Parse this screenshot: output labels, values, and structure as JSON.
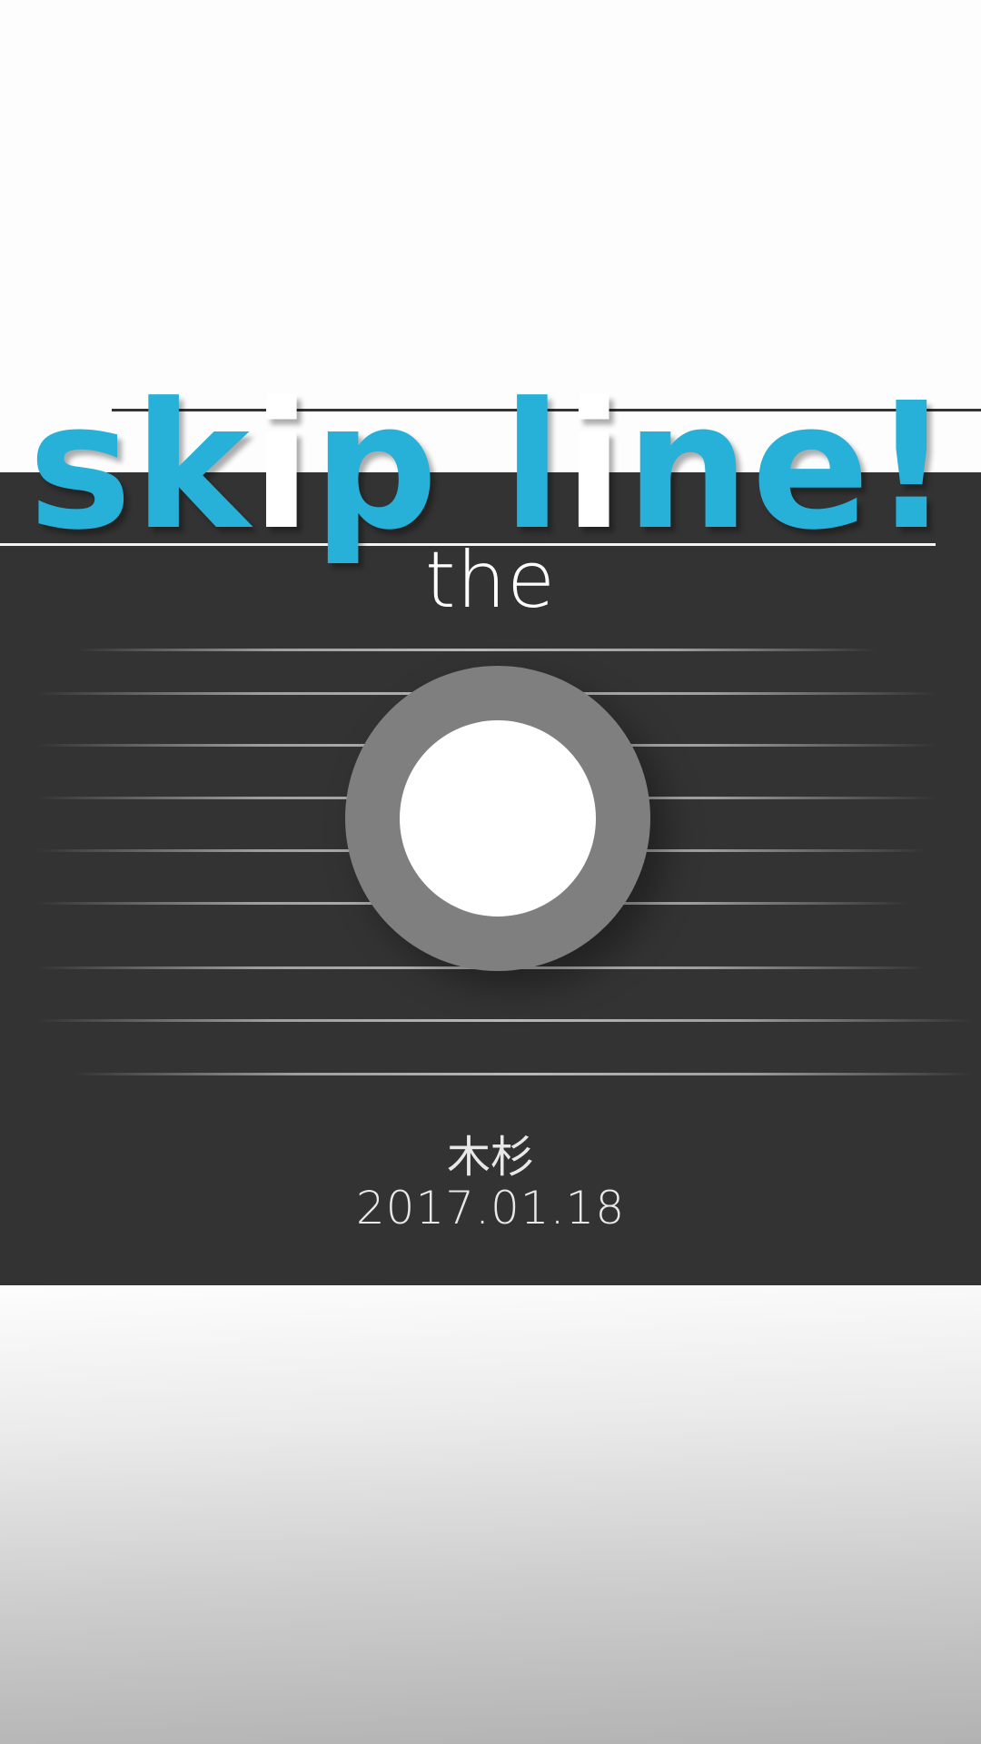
{
  "title": {
    "parts": [
      {
        "text": "sk",
        "highlight": false
      },
      {
        "text": "i",
        "highlight": true
      },
      {
        "text": "p l",
        "highlight": false
      },
      {
        "text": "i",
        "highlight": true
      },
      {
        "text": "ne!",
        "highlight": false
      }
    ],
    "accent_color": "#27b0d8",
    "highlight_color": "#ffffff"
  },
  "subtitle": "the",
  "author": "木杉",
  "date": "2017.01.18",
  "colors": {
    "panel": "#333333",
    "ring": "#7f7f7f",
    "ring_core": "#ffffff"
  },
  "icons": {
    "logo": "play-button-ring-icon"
  }
}
